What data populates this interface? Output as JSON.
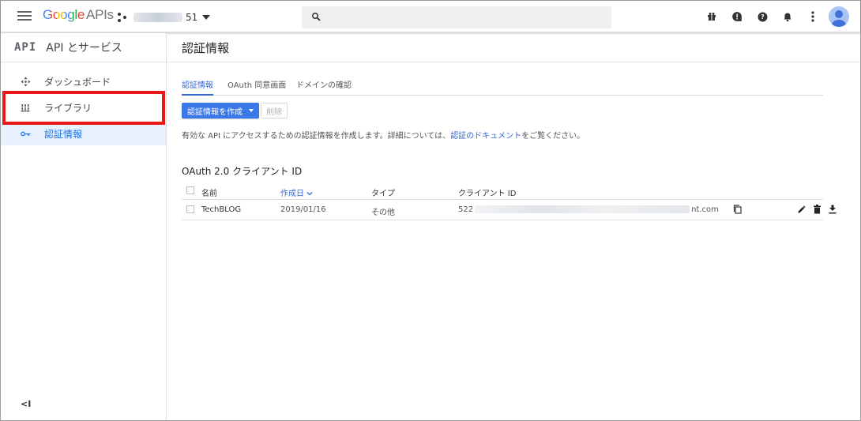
{
  "header": {
    "logo_google": "Google",
    "logo_apis": "APIs",
    "project_suffix": "51",
    "search_placeholder": ""
  },
  "sidebar": {
    "badge": "API",
    "title": "API とサービス",
    "items": [
      {
        "label": "ダッシュボード",
        "icon": "dashboard-icon"
      },
      {
        "label": "ライブラリ",
        "icon": "library-icon"
      },
      {
        "label": "認証情報",
        "icon": "key-icon",
        "active": true
      }
    ],
    "collapse_label": "<I"
  },
  "main": {
    "title": "認証情報",
    "tabs": [
      "認証情報",
      "OAuth 同意画面",
      "ドメインの確認"
    ],
    "create_button": "認証情報を作成",
    "delete_button": "削除",
    "description_prefix": "有効な API にアクセスするための認証情報を作成します。詳細については、",
    "description_link": "認証のドキュメント",
    "description_suffix": "をご覧ください。",
    "section_title": "OAuth 2.0 クライアント ID",
    "table": {
      "headers": [
        "名前",
        "作成日",
        "タイプ",
        "クライアント ID"
      ],
      "rows": [
        {
          "name": "TechBLOG",
          "date": "2019/01/16",
          "type": "その他",
          "client_id_prefix": "522",
          "client_id_suffix": "nt.com"
        }
      ]
    }
  },
  "colors": {
    "accent": "#3b78e7",
    "link": "#3367d6",
    "highlight": "#e81818",
    "active_bg": "#e8f0fe"
  }
}
